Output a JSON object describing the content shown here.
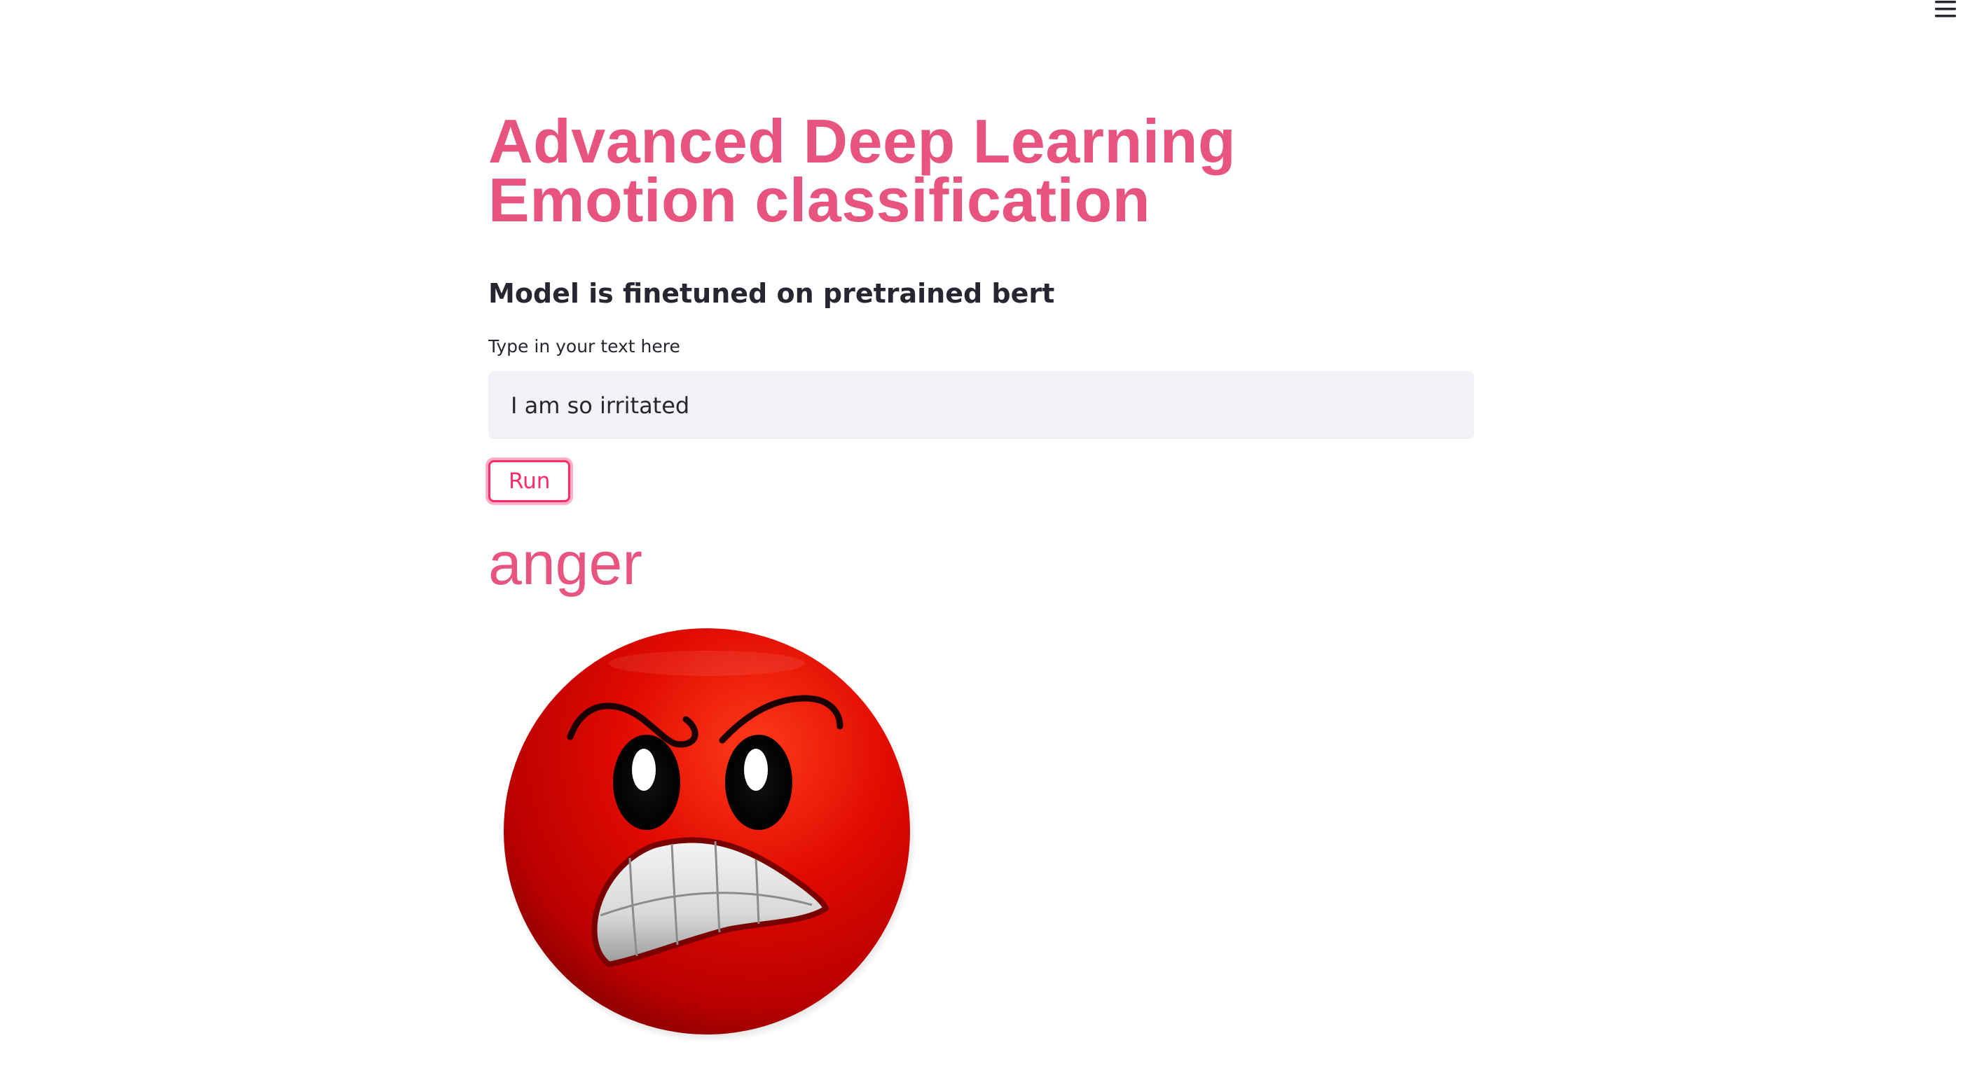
{
  "header": {
    "menu_icon": "hamburger-menu-icon"
  },
  "main": {
    "title": "Advanced Deep Learning Emotion classification",
    "subtitle": "Model is finetuned on pretrained bert",
    "input": {
      "label": "Type in your text here",
      "value": "I am so irritated"
    },
    "run_label": "Run",
    "prediction": "anger",
    "result_image": "angry-face-emoji"
  },
  "colors": {
    "accent": "#e75480",
    "button_border": "#ff2b6b",
    "input_bg": "#f0f2f6",
    "text": "#262730",
    "emoji_red": "#d90000"
  }
}
